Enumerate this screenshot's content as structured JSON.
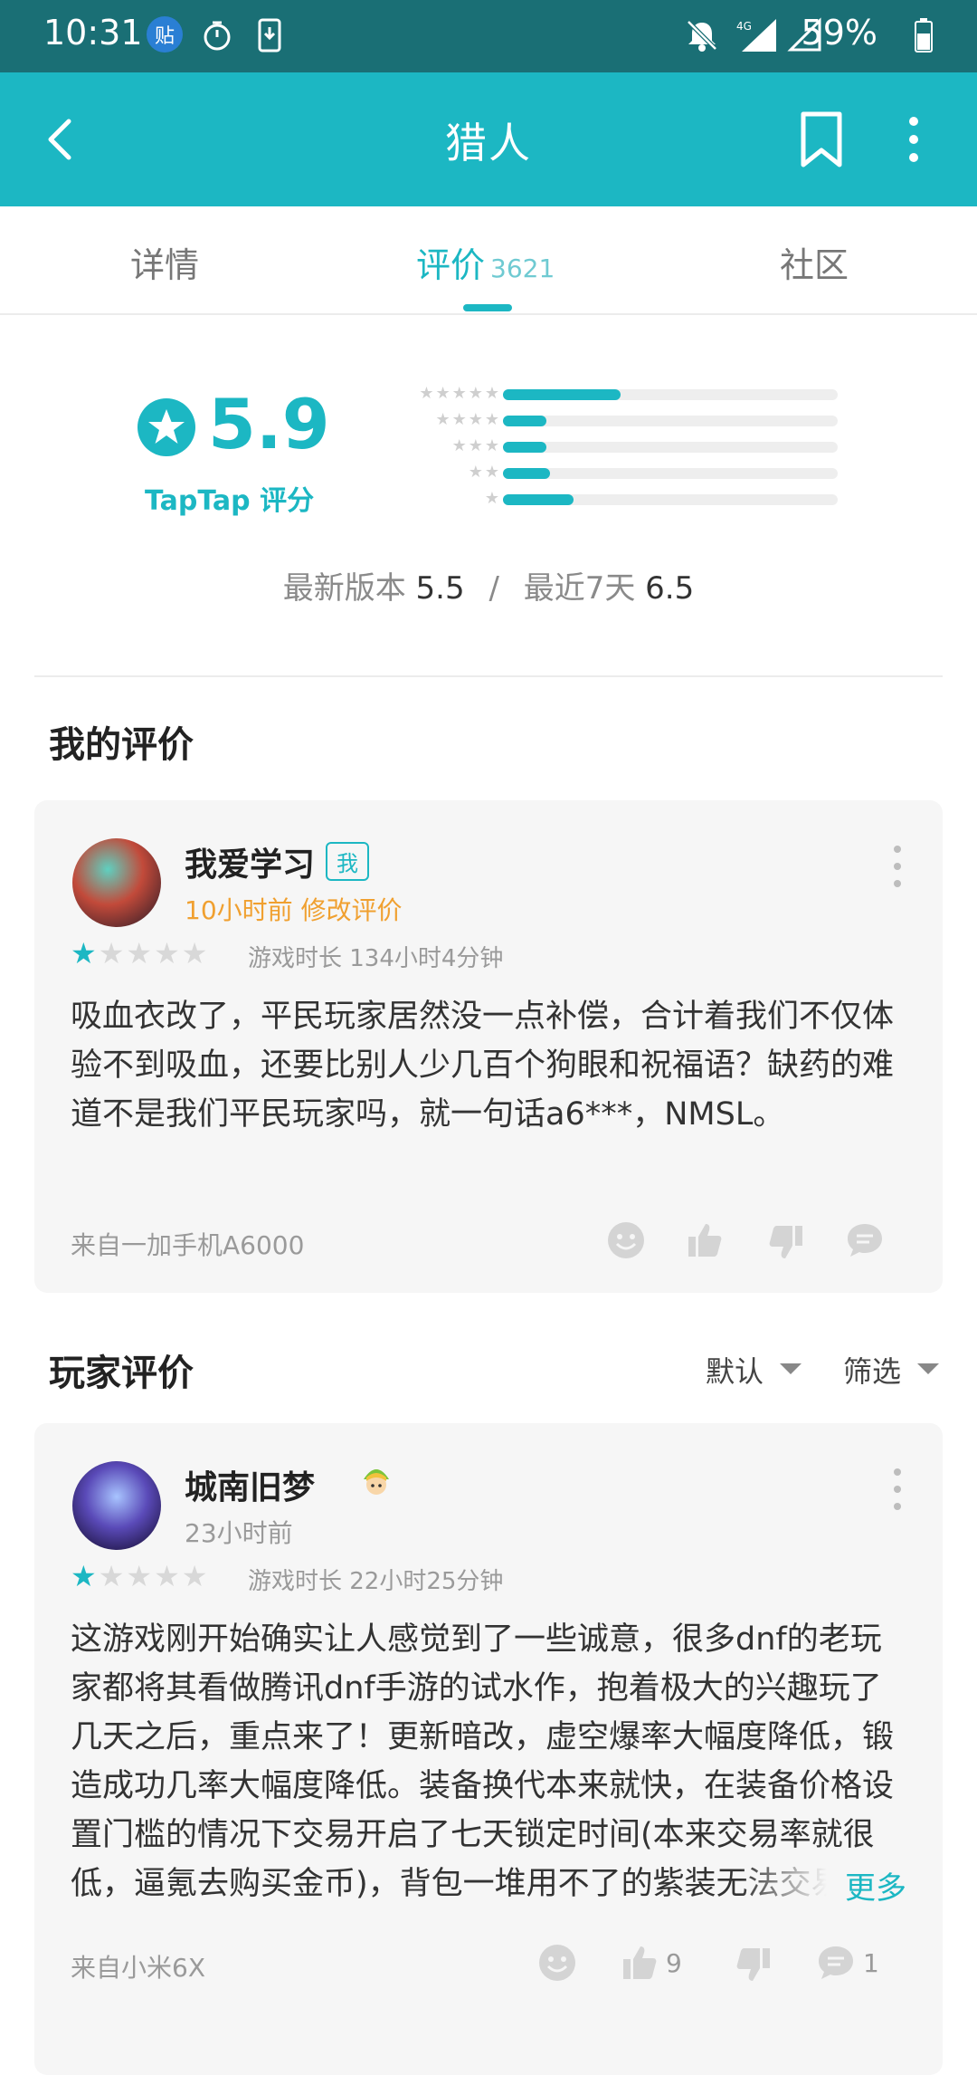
{
  "status_bar": {
    "time": "10:31",
    "battery": "59%",
    "notif_badge": "贴",
    "signal_label": "4G"
  },
  "app_bar": {
    "title": "猎人"
  },
  "tabs": [
    {
      "label": "详情"
    },
    {
      "label": "评价",
      "count": "3621"
    },
    {
      "label": "社区"
    }
  ],
  "rating": {
    "score": "5.9",
    "label": "TapTap 评分",
    "distribution": [
      0.35,
      0.13,
      0.13,
      0.14,
      0.21
    ],
    "latest_version_label": "最新版本",
    "latest_version_score": "5.5",
    "separator": "/",
    "recent_label": "最近7天",
    "recent_score": "6.5"
  },
  "my_review": {
    "section_title": "我的评价",
    "user": "我爱学习",
    "me_badge": "我",
    "time_edit": "10小时前 修改评价",
    "stars": 1,
    "playtime": "游戏时长 134小时4分钟",
    "text": "吸血衣改了，平民玩家居然没一点补偿，合计着我们不仅体验不到吸血，还要比别人少几百个狗眼和祝福语？缺药的难道不是我们平民玩家吗，就一句话a6***，NMSL。",
    "source": "来自一加手机A6000"
  },
  "player_reviews": {
    "section_title": "玩家评价",
    "sort_label": "默认",
    "filter_label": "筛选",
    "items": [
      {
        "user": "城南旧梦",
        "time": "23小时前",
        "stars": 1,
        "playtime": "游戏时长 22小时25分钟",
        "text": "这游戏刚开始确实让人感觉到了一些诚意，很多dnf的老玩家都将其看做腾讯dnf手游的试水作，抱着极大的兴趣玩了几天之后，重点来了！更新暗改，虚空爆率大幅度降低，锻造成功几率大幅度降低。装备换代本来就快，在装备价格设置门槛的情况下交易开启了七天锁定时间(本来交易率就很低，逼氪去购买金币)，背包一堆用不了的紫装无法交易的情况下只能分解，分解以后的材料",
        "more": "更多",
        "source": "来自小米6X",
        "likes": "9",
        "comments": "1"
      }
    ]
  },
  "colors": {
    "accent": "#1cb7c3",
    "status_bar": "#1a6f75",
    "orange": "#f0a030"
  }
}
